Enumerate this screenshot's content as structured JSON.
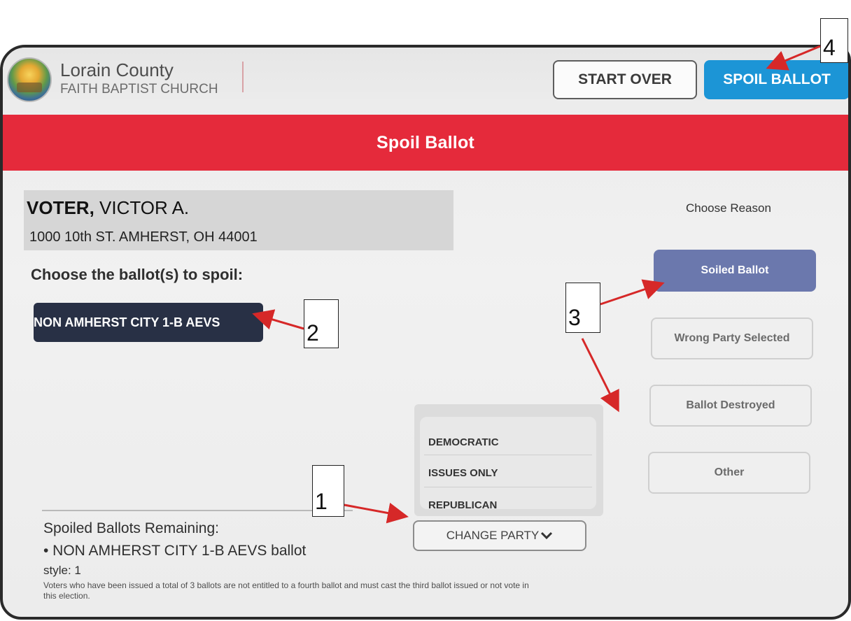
{
  "header": {
    "county": "Lorain County",
    "site": "FAITH BAPTIST CHURCH",
    "start_over_label": "START OVER",
    "spoil_ballot_label": "SPOIL BALLOT"
  },
  "title_band": "Spoil Ballot",
  "voter": {
    "last_name": "VOTER,",
    "first_name": "VICTOR A.",
    "address": "1000 10th ST. AMHERST, OH 44001"
  },
  "ballot_section": {
    "label": "Choose the ballot(s) to spoil:",
    "ballot_chip": "NON AMHERST CITY 1-B AEVS"
  },
  "reasons": {
    "label": "Choose Reason",
    "options": [
      "Soiled Ballot",
      "Wrong Party Selected",
      "Ballot Destroyed",
      "Other"
    ],
    "selected": "Soiled Ballot"
  },
  "party_dropdown": {
    "options": [
      "DEMOCRATIC",
      "ISSUES ONLY",
      "REPUBLICAN"
    ],
    "button_label": "CHANGE PARTY"
  },
  "remaining": {
    "title": "Spoiled Ballots Remaining:",
    "item": "• NON AMHERST CITY 1-B AEVS ballot",
    "style": "style: 1",
    "note": "Voters who have been issued a total of 3 ballots are not entitled to a fourth ballot and must cast the third ballot issued or not vote in this election."
  },
  "callouts": [
    "1",
    "2",
    "3",
    "4"
  ],
  "colors": {
    "title_band": "#e52a3b",
    "spoil_button": "#1c95d6",
    "selected_reason": "#6b78ad",
    "ballot_chip": "#283045",
    "arrow": "#d62828"
  }
}
